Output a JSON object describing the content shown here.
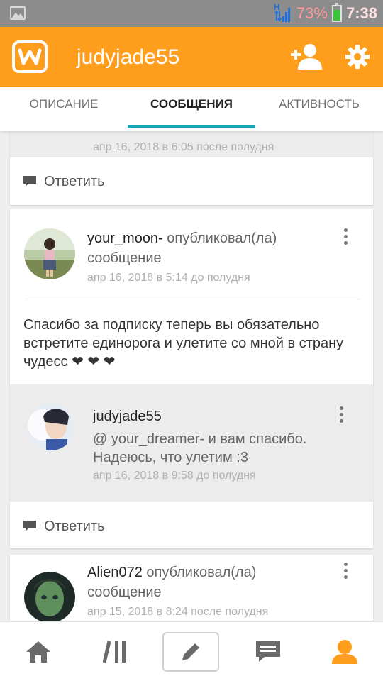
{
  "status_bar": {
    "battery_percent": "73%",
    "time": "7:38",
    "network_label": "H"
  },
  "app_bar": {
    "title": "judyjade55"
  },
  "tabs": [
    {
      "label": "ОПИСАНИЕ",
      "active": false
    },
    {
      "label": "СООБЩЕНИЯ",
      "active": true
    },
    {
      "label": "АКТИВНОСТЬ",
      "active": false
    }
  ],
  "feed": {
    "partial_card": {
      "timestamp": "апр 16, 2018 в 6:05 после полудня",
      "reply_label": "Ответить"
    },
    "post1": {
      "author": "your_moon-",
      "action": " опубликовал(ла)",
      "action2": "сообщение",
      "timestamp": "апр 16, 2018 в 5:14 до полудня",
      "body": "Спасибо за подписку теперь вы обязательно встретите единорога и улетите со мной в страну чудесс ❤ ❤ ❤",
      "reply": {
        "author": "judyjade55",
        "text": "@ your_dreamer-  и вам спасибо. Надеюсь, что улетим :3",
        "timestamp": "апр 16, 2018 в 9:58 до полудня"
      },
      "reply_label": "Ответить"
    },
    "post2": {
      "author": "Alien072",
      "action": " опубликовал(ла)",
      "action2": "сообщение",
      "timestamp": "апр 15, 2018 в 8:24 после полудня"
    }
  },
  "bottom_nav": {
    "items": [
      {
        "icon": "home-icon"
      },
      {
        "icon": "library-icon"
      },
      {
        "icon": "pencil-icon",
        "selected": true
      },
      {
        "icon": "messages-icon"
      },
      {
        "icon": "profile-icon",
        "active": true
      }
    ]
  },
  "colors": {
    "accent": "#ff9d1c",
    "tab_indicator": "#1aa0ae",
    "profile_active": "#ff9d1c"
  }
}
